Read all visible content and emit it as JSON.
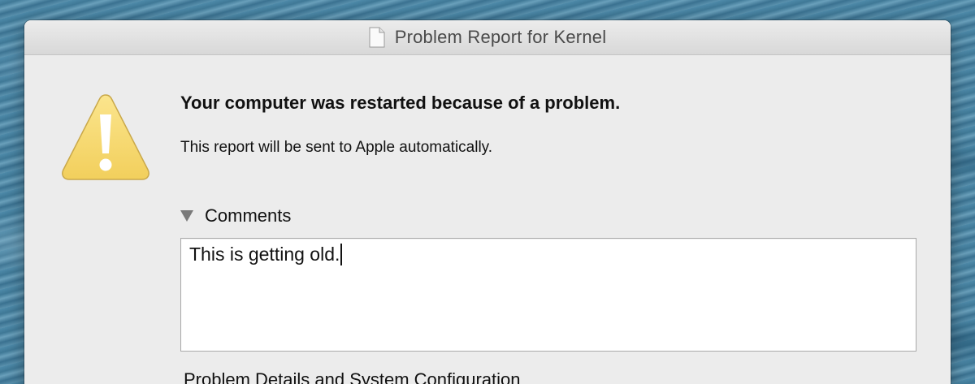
{
  "window": {
    "title": "Problem Report for Kernel",
    "title_icon": "document-icon"
  },
  "alert": {
    "icon": "warning-icon",
    "icon_color": "#f7d76a",
    "headline": "Your computer was restarted because of a problem.",
    "message": "This report will be sent to Apple automatically."
  },
  "comments": {
    "section_label": "Comments",
    "expanded": true,
    "value": "This is getting old."
  },
  "details": {
    "section_label": "Problem Details and System Configuration"
  }
}
